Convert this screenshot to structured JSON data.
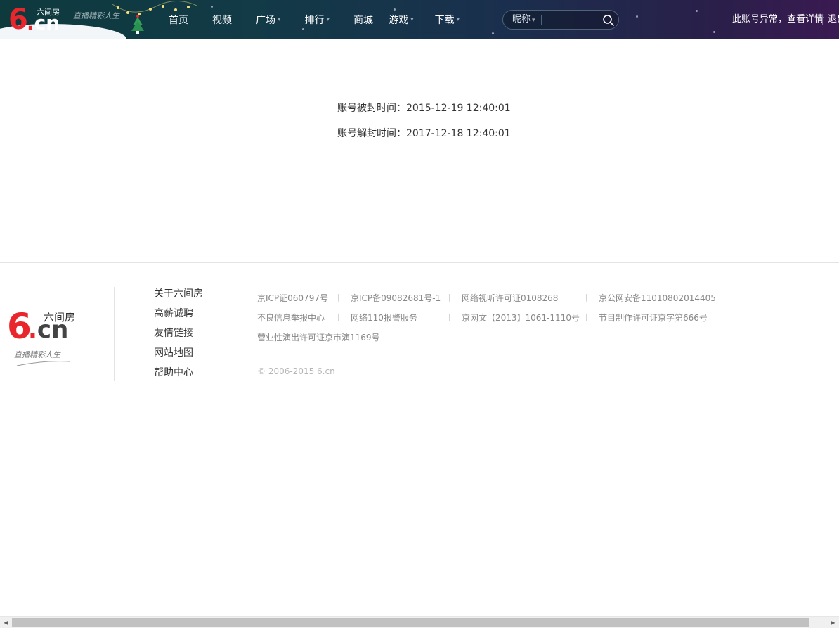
{
  "header": {
    "logo": {
      "six": "6",
      "dot": ".",
      "cn": "cn",
      "name": "六间房"
    },
    "slogan": "直播精彩人生",
    "nav": [
      {
        "label": "首页",
        "dropdown": false
      },
      {
        "label": "视频",
        "dropdown": false
      },
      {
        "label": "广场",
        "dropdown": true
      },
      {
        "label": "排行",
        "dropdown": true
      },
      {
        "label": "商城",
        "dropdown": false
      },
      {
        "label": "游戏",
        "dropdown": true
      },
      {
        "label": "下载",
        "dropdown": true
      }
    ],
    "dropdown_caret": "▾",
    "search": {
      "type_label": "昵称",
      "value": "",
      "placeholder": ""
    },
    "account_warning": "此账号异常，查看详情",
    "logout": "退出"
  },
  "ban": {
    "banned_label": "账号被封时间：",
    "banned_time": "2015-12-19 12:40:01",
    "unban_label": "账号解封时间：",
    "unban_time": "2017-12-18 12:40:01"
  },
  "footer": {
    "logo": {
      "six": "6",
      "dot": ".",
      "cn": "cn",
      "name": "六间房"
    },
    "slogan": "直播精彩人生",
    "links": [
      "关于六间房",
      "高薪诚聘",
      "友情链接",
      "网站地图",
      "帮助中心"
    ],
    "licenses": {
      "row1": [
        "京ICP证060797号",
        "京ICP备09082681号-1",
        "网络视听许可证0108268",
        "京公网安备11010802014405"
      ],
      "row2": [
        "不良信息举报中心",
        "网络110报警服务",
        "京网文【2013】1061-1110号",
        "节目制作许可证京字第666号"
      ],
      "row3": [
        "营业性演出许可证京市演1169号"
      ]
    },
    "separator": "|",
    "copyright": "© 2006-2015 6.cn"
  },
  "colors": {
    "brand_red": "#e8262c",
    "header_start": "#0e3a3e",
    "header_end": "#3a1a52"
  },
  "icons": {
    "search": "search-icon",
    "tree": "christmas-tree-icon",
    "scroll_left": "scroll-left-arrow-icon",
    "scroll_right": "scroll-right-arrow-icon"
  },
  "scroll_icons": {
    "left": "◀",
    "right": "▶"
  }
}
